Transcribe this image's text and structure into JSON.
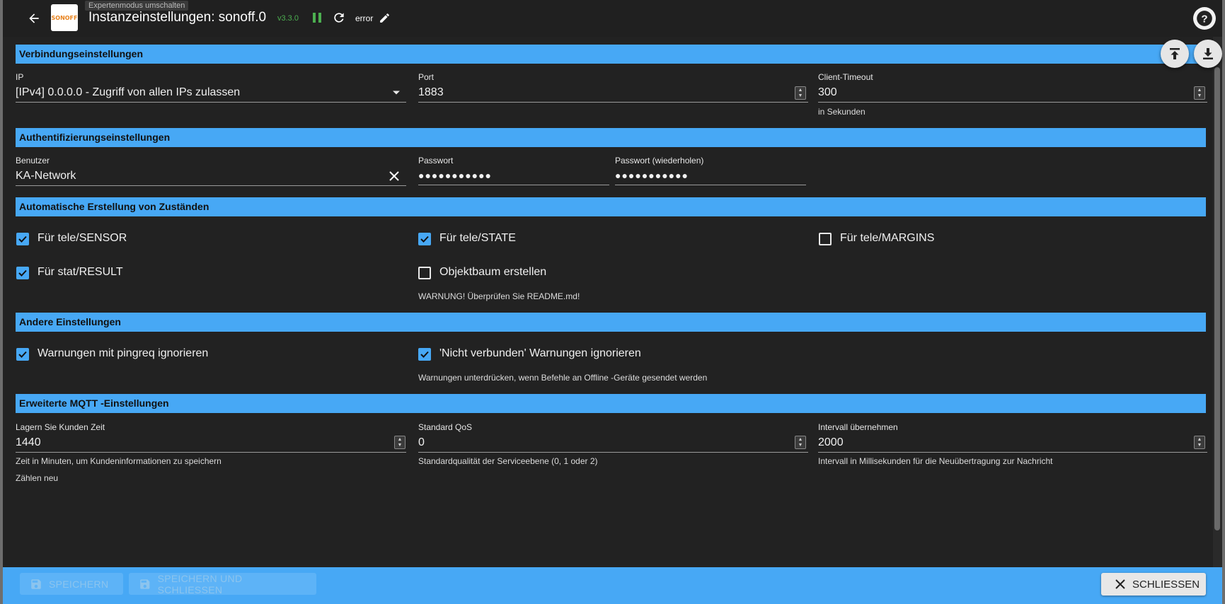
{
  "header": {
    "title_prefix": "Instanzeinstellungen:",
    "instance": "sonoff.0",
    "version": "v3.3.0",
    "status": "error",
    "logo_text": "SONOFF",
    "tooltip": "Expertenmodus umschalten",
    "icons": [
      "arrow-left-icon",
      "pause-icon",
      "refresh-icon",
      "pencil-icon",
      "help-icon",
      "upload-icon",
      "download-icon"
    ],
    "colors": {
      "version": "#4caf50",
      "pause": "#4caf50"
    }
  },
  "sections": {
    "connection": "Verbindungseinstellungen",
    "auth": "Authentifizierungseinstellungen",
    "auto": "Automatische Erstellung von Zuständen",
    "other": "Andere Einstellungen",
    "mqtt": "Erweiterte MQTT -Einstellungen"
  },
  "connection": {
    "ip_label": "IP",
    "ip_value": "[IPv4] 0.0.0.0 - Zugriff von allen IPs zulassen",
    "port_label": "Port",
    "port_value": "1883",
    "timeout_label": "Client-Timeout",
    "timeout_value": "300",
    "timeout_helper": "in Sekunden"
  },
  "auth": {
    "user_label": "Benutzer",
    "user_value": "KA-Network",
    "password_label": "Passwort",
    "password_value": "●●●●●●●●●●●",
    "password_repeat_label": "Passwort (wiederholen)",
    "password_repeat_value": "●●●●●●●●●●●"
  },
  "auto": {
    "tele_sensor": {
      "label": "Für tele/SENSOR",
      "checked": true
    },
    "tele_state": {
      "label": "Für tele/STATE",
      "checked": true
    },
    "tele_margins": {
      "label": "Für tele/MARGINS",
      "checked": false
    },
    "stat_result": {
      "label": "Für stat/RESULT",
      "checked": true
    },
    "object_tree": {
      "label": "Objektbaum erstellen",
      "checked": false
    },
    "object_tree_warning": "WARNUNG! Überprüfen Sie README.md!"
  },
  "other": {
    "ignore_pingreq": {
      "label": "Warnungen mit pingreq ignorieren",
      "checked": true
    },
    "ignore_not_connected": {
      "label": "'Nicht verbunden' Warnungen ignorieren",
      "checked": true
    },
    "not_connected_helper": "Warnungen unterdrücken, wenn Befehle an Offline -Geräte gesendet werden"
  },
  "mqtt": {
    "store_label": "Lagern Sie Kunden Zeit",
    "store_value": "1440",
    "store_helper": "Zeit in Minuten, um Kundeninformationen zu speichern",
    "qos_label": "Standard QoS",
    "qos_value": "0",
    "qos_helper": "Standardqualität der Serviceebene (0, 1 oder 2)",
    "interval_label": "Intervall übernehmen",
    "interval_value": "2000",
    "interval_helper": "Intervall in Millisekunden für die Neuübertragung zur Nachricht",
    "recount_label": "Zählen neu"
  },
  "footer": {
    "save": "SPEICHERN",
    "save_close": "SPEICHERN UND SCHLIESSEN",
    "close": "SCHLIESSEN"
  },
  "colors": {
    "accent": "#47a8f5",
    "background": "#222222",
    "topbar": "#202020"
  }
}
